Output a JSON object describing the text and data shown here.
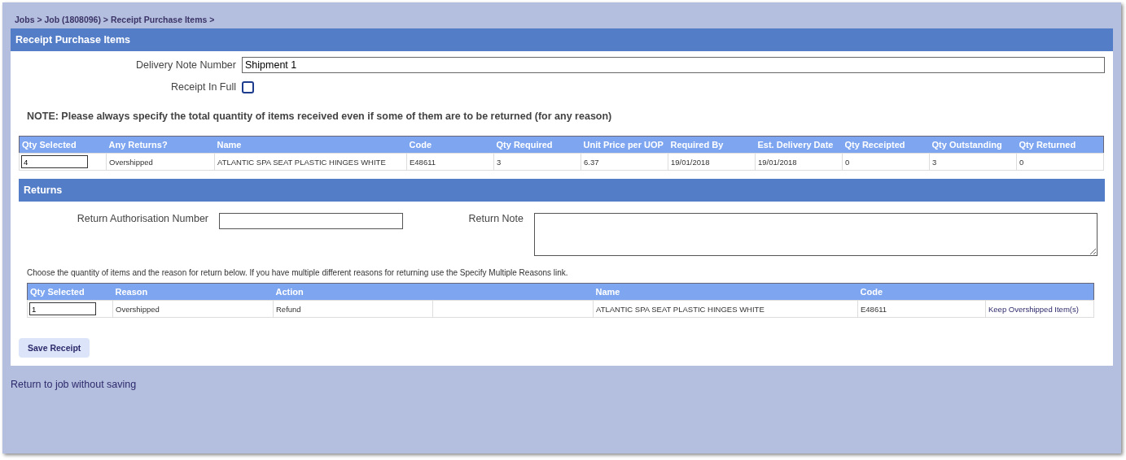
{
  "breadcrumb": "Jobs > Job (1808096) > Receipt Purchase Items >",
  "panel": {
    "title": "Receipt Purchase Items"
  },
  "delivery_note": {
    "label": "Delivery Note Number",
    "value": "Shipment 1"
  },
  "receipt_in_full": {
    "label": "Receipt In Full",
    "checked": false
  },
  "note": "NOTE: Please always specify the total quantity of items received even if some of them are to be returned (for any reason)",
  "items_table": {
    "columns": [
      "Qty Selected",
      "Any Returns?",
      "Name",
      "Code",
      "Qty Required",
      "Unit Price per UOP",
      "Required By",
      "Est. Delivery Date",
      "Qty Receipted",
      "Qty Outstanding",
      "Qty Returned"
    ],
    "rows": [
      {
        "cells": [
          {
            "kind": "input",
            "text": "4"
          },
          {
            "kind": "text",
            "text": "Overshipped"
          },
          {
            "kind": "text",
            "text": "ATLANTIC SPA SEAT PLASTIC HINGES WHITE"
          },
          {
            "kind": "text",
            "text": "E48611"
          },
          {
            "kind": "text",
            "text": "3"
          },
          {
            "kind": "text",
            "text": "6.37"
          },
          {
            "kind": "text",
            "text": "19/01/2018"
          },
          {
            "kind": "text",
            "text": "19/01/2018"
          },
          {
            "kind": "text",
            "text": "0"
          },
          {
            "kind": "text",
            "text": "3"
          },
          {
            "kind": "text",
            "text": "0"
          }
        ]
      }
    ]
  },
  "returns": {
    "title": "Returns",
    "authorisation": {
      "label": "Return Authorisation Number"
    },
    "return_note": {
      "label": "Return Note"
    },
    "instructions": "Choose the quantity of items and the reason for return below. If you have multiple different reasons for returning use the Specify Multiple Reasons link.",
    "table": {
      "columns": [
        "Qty Selected",
        "Reason",
        "Action",
        "",
        "Name",
        "Code",
        ""
      ],
      "rows": [
        {
          "cells": [
            {
              "kind": "input",
              "text": "1"
            },
            {
              "kind": "text",
              "text": "Overshipped"
            },
            {
              "kind": "text",
              "text": "Refund"
            },
            {
              "kind": "blank"
            },
            {
              "kind": "text",
              "text": "ATLANTIC SPA SEAT PLASTIC HINGES WHITE"
            },
            {
              "kind": "text",
              "text": "E48611"
            },
            {
              "kind": "link",
              "text": "Keep Overshipped Item(s)"
            }
          ]
        }
      ]
    }
  },
  "save_button": "Save Receipt",
  "return_link": "Return to job without saving"
}
